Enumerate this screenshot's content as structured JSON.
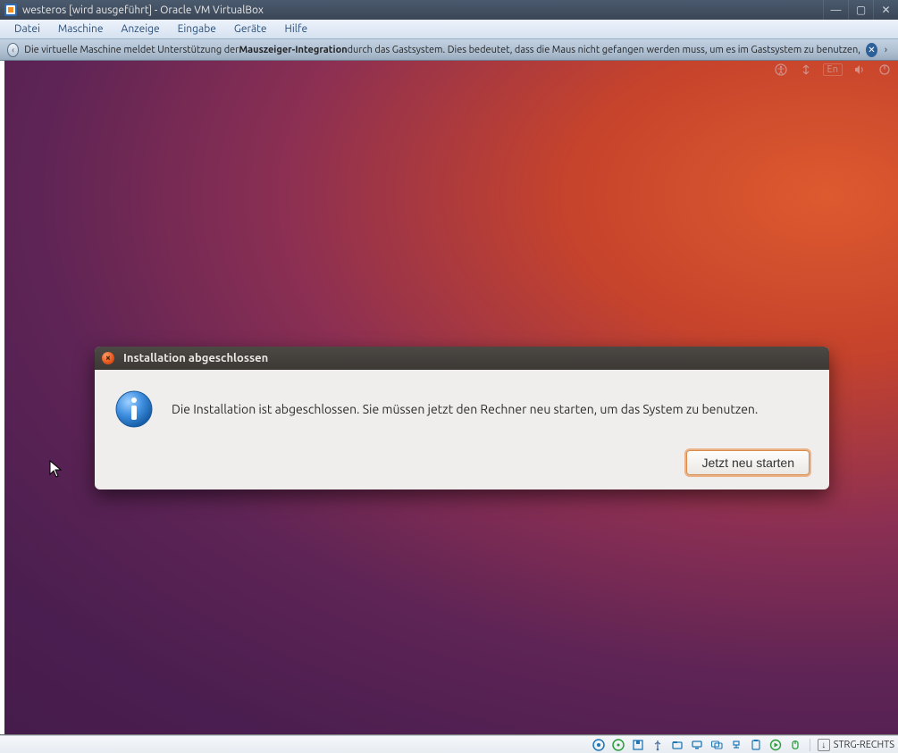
{
  "window": {
    "title": "westeros [wird ausgeführt] - Oracle VM VirtualBox"
  },
  "menu": {
    "items": [
      {
        "label": "Datei"
      },
      {
        "label": "Maschine"
      },
      {
        "label": "Anzeige"
      },
      {
        "label": "Eingabe"
      },
      {
        "label": "Geräte"
      },
      {
        "label": "Hilfe"
      }
    ]
  },
  "info_bar": {
    "pre": "Die virtuelle Maschine meldet Unterstützung der ",
    "bold": "Mauszeiger-Integration",
    "post": " durch das Gastsystem. Dies bedeutet, dass die Maus nicht gefangen werden muss, um es im Gastsystem zu benutzen,"
  },
  "guest_top": {
    "lang": "En"
  },
  "dialog": {
    "title": "Installation abgeschlossen",
    "message": "Die Installation ist abgeschlossen. Sie müssen jetzt den Rechner neu starten, um das System zu benutzen.",
    "primary_button": "Jetzt neu starten"
  },
  "status_bar": {
    "host_key": "STRG-RECHTS"
  }
}
